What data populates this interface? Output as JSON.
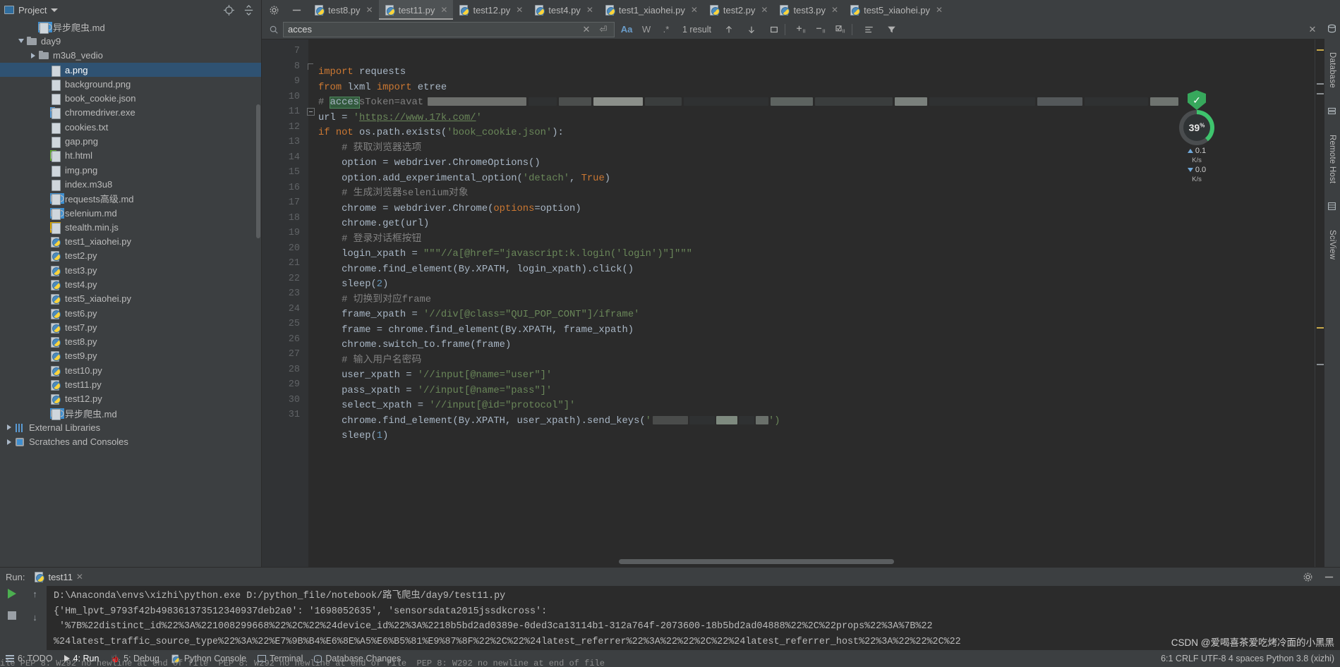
{
  "window": {
    "project_panel_title": "Project",
    "icons": {
      "locate": "crosshair-icon",
      "collapse": "collapse-all-icon",
      "settings": "gear-icon",
      "minimize": "minimize-icon",
      "project_view": "project-view-icon",
      "chevron": "chevron-down-icon"
    }
  },
  "sidebar": {
    "items": [
      {
        "label": "异步爬虫.md",
        "icon": "md-file-icon",
        "indent": 2,
        "kind": "md",
        "arrow": "none",
        "selected": false,
        "clipped": true
      },
      {
        "label": "day9",
        "icon": "folder-icon",
        "indent": 1,
        "kind": "folder",
        "arrow": "open",
        "selected": false
      },
      {
        "label": "m3u8_vedio",
        "icon": "folder-icon",
        "indent": 2,
        "kind": "folder",
        "arrow": "closed",
        "selected": false
      },
      {
        "label": "a.png",
        "icon": "png-file-icon",
        "indent": 3,
        "kind": "png",
        "arrow": "none",
        "selected": true
      },
      {
        "label": "background.png",
        "icon": "png-file-icon",
        "indent": 3,
        "kind": "png",
        "arrow": "none",
        "selected": false
      },
      {
        "label": "book_cookie.json",
        "icon": "json-file-icon",
        "indent": 3,
        "kind": "json",
        "arrow": "none",
        "selected": false
      },
      {
        "label": "chromedriver.exe",
        "icon": "exe-file-icon",
        "indent": 3,
        "kind": "exe",
        "arrow": "none",
        "selected": false
      },
      {
        "label": "cookies.txt",
        "icon": "txt-file-icon",
        "indent": 3,
        "kind": "txt",
        "arrow": "none",
        "selected": false
      },
      {
        "label": "gap.png",
        "icon": "png-file-icon",
        "indent": 3,
        "kind": "png",
        "arrow": "none",
        "selected": false
      },
      {
        "label": "ht.html",
        "icon": "html-file-icon",
        "indent": 3,
        "kind": "html",
        "arrow": "none",
        "selected": false
      },
      {
        "label": "img.png",
        "icon": "png-file-icon",
        "indent": 3,
        "kind": "png",
        "arrow": "none",
        "selected": false
      },
      {
        "label": "index.m3u8",
        "icon": "file-icon",
        "indent": 3,
        "kind": "doc",
        "arrow": "none",
        "selected": false
      },
      {
        "label": "requests高级.md",
        "icon": "md-file-icon",
        "indent": 3,
        "kind": "md",
        "arrow": "none",
        "selected": false
      },
      {
        "label": "selenium.md",
        "icon": "md-file-icon",
        "indent": 3,
        "kind": "md",
        "arrow": "none",
        "selected": false
      },
      {
        "label": "stealth.min.js",
        "icon": "js-file-icon",
        "indent": 3,
        "kind": "js",
        "arrow": "none",
        "selected": false
      },
      {
        "label": "test1_xiaohei.py",
        "icon": "python-file-icon",
        "indent": 3,
        "kind": "py",
        "arrow": "none",
        "selected": false
      },
      {
        "label": "test2.py",
        "icon": "python-file-icon",
        "indent": 3,
        "kind": "py",
        "arrow": "none",
        "selected": false
      },
      {
        "label": "test3.py",
        "icon": "python-file-icon",
        "indent": 3,
        "kind": "py",
        "arrow": "none",
        "selected": false
      },
      {
        "label": "test4.py",
        "icon": "python-file-icon",
        "indent": 3,
        "kind": "py",
        "arrow": "none",
        "selected": false
      },
      {
        "label": "test5_xiaohei.py",
        "icon": "python-file-icon",
        "indent": 3,
        "kind": "py",
        "arrow": "none",
        "selected": false
      },
      {
        "label": "test6.py",
        "icon": "python-file-icon",
        "indent": 3,
        "kind": "py",
        "arrow": "none",
        "selected": false
      },
      {
        "label": "test7.py",
        "icon": "python-file-icon",
        "indent": 3,
        "kind": "py",
        "arrow": "none",
        "selected": false
      },
      {
        "label": "test8.py",
        "icon": "python-file-icon",
        "indent": 3,
        "kind": "py",
        "arrow": "none",
        "selected": false
      },
      {
        "label": "test9.py",
        "icon": "python-file-icon",
        "indent": 3,
        "kind": "py",
        "arrow": "none",
        "selected": false
      },
      {
        "label": "test10.py",
        "icon": "python-file-icon",
        "indent": 3,
        "kind": "py",
        "arrow": "none",
        "selected": false
      },
      {
        "label": "test11.py",
        "icon": "python-file-icon",
        "indent": 3,
        "kind": "py",
        "arrow": "none",
        "selected": false
      },
      {
        "label": "test12.py",
        "icon": "python-file-icon",
        "indent": 3,
        "kind": "py",
        "arrow": "none",
        "selected": false
      },
      {
        "label": "异步爬虫.md",
        "icon": "md-file-icon",
        "indent": 3,
        "kind": "md",
        "arrow": "none",
        "selected": false
      },
      {
        "label": "External Libraries",
        "icon": "library-icon",
        "indent": 0,
        "kind": "lib",
        "arrow": "closed",
        "selected": false
      },
      {
        "label": "Scratches and Consoles",
        "icon": "scratches-icon",
        "indent": 0,
        "kind": "scratch",
        "arrow": "closed",
        "selected": false
      }
    ]
  },
  "tabs": [
    {
      "label": "test8.py",
      "active": false
    },
    {
      "label": "test11.py",
      "active": true
    },
    {
      "label": "test12.py",
      "active": false
    },
    {
      "label": "test4.py",
      "active": false
    },
    {
      "label": "test1_xiaohei.py",
      "active": false
    },
    {
      "label": "test2.py",
      "active": false
    },
    {
      "label": "test3.py",
      "active": false
    },
    {
      "label": "test5_xiaohei.py",
      "active": false
    }
  ],
  "find": {
    "query": "acces",
    "placeholder": "Search",
    "result_count": "1 result",
    "match_case_label": "Aa",
    "words_label": "W",
    "regex_label": ".*",
    "icons": {
      "search": "search-icon",
      "clear": "close-icon",
      "reset": "reset-icon",
      "prev": "arrow-up-icon",
      "next": "arrow-down-icon",
      "select_all": "select-all-icon",
      "add_line": "add-selection-icon",
      "remove_line": "remove-selection-icon",
      "check_lines": "check-selection-icon",
      "indent": "indent-icon",
      "filter": "filter-icon"
    }
  },
  "editor": {
    "first_line_number": 7,
    "lines": [
      {
        "n": 7,
        "fold": "none",
        "segments": [
          {
            "t": "import",
            "c": "kw"
          },
          {
            "t": " requests",
            "c": ""
          }
        ]
      },
      {
        "n": 8,
        "fold": "corner",
        "segments": [
          {
            "t": "from",
            "c": "kw"
          },
          {
            "t": " lxml ",
            "c": ""
          },
          {
            "t": "import",
            "c": "kw"
          },
          {
            "t": " etree",
            "c": ""
          }
        ]
      },
      {
        "n": 9,
        "fold": "none",
        "segments": [
          {
            "t": "# ",
            "c": "cmt"
          },
          {
            "t": "acces",
            "c": "hl"
          },
          {
            "t": "sToken=avat",
            "c": "cmt"
          }
        ],
        "redacted": true
      },
      {
        "n": 10,
        "fold": "none",
        "segments": [
          {
            "t": "url = ",
            "c": ""
          },
          {
            "t": "'",
            "c": "str"
          },
          {
            "t": "https://www.17k.com/",
            "c": "link"
          },
          {
            "t": "'",
            "c": "str"
          }
        ]
      },
      {
        "n": 11,
        "fold": "minus",
        "segments": [
          {
            "t": "if not",
            "c": "kw"
          },
          {
            "t": " os.path.exists(",
            "c": ""
          },
          {
            "t": "'book_cookie.json'",
            "c": "str"
          },
          {
            "t": "):",
            "c": ""
          }
        ]
      },
      {
        "n": 12,
        "fold": "none",
        "segments": [
          {
            "t": "    # 获取浏览器选项",
            "c": "cmt"
          }
        ]
      },
      {
        "n": 13,
        "fold": "none",
        "segments": [
          {
            "t": "    option = webdriver.ChromeOptions()",
            "c": ""
          }
        ]
      },
      {
        "n": 14,
        "fold": "none",
        "segments": [
          {
            "t": "    option.add_experimental_option(",
            "c": ""
          },
          {
            "t": "'detach'",
            "c": "str"
          },
          {
            "t": ", ",
            "c": ""
          },
          {
            "t": "True",
            "c": "kw"
          },
          {
            "t": ")",
            "c": ""
          }
        ]
      },
      {
        "n": 15,
        "fold": "none",
        "segments": [
          {
            "t": "    # 生成浏览器selenium对象",
            "c": "cmt"
          }
        ]
      },
      {
        "n": 16,
        "fold": "none",
        "segments": [
          {
            "t": "    chrome = webdriver.Chrome(",
            "c": ""
          },
          {
            "t": "options",
            "c": "param"
          },
          {
            "t": "=option)",
            "c": ""
          }
        ]
      },
      {
        "n": 17,
        "fold": "none",
        "segments": [
          {
            "t": "    chrome.get(url)",
            "c": ""
          }
        ]
      },
      {
        "n": 18,
        "fold": "none",
        "segments": [
          {
            "t": "    # 登录对话框按钮",
            "c": "cmt"
          }
        ]
      },
      {
        "n": 19,
        "fold": "none",
        "segments": [
          {
            "t": "    login_xpath = ",
            "c": ""
          },
          {
            "t": "\"\"\"//a[@href=\"javascript:k.login('login')\"]\"\"\"",
            "c": "str"
          }
        ]
      },
      {
        "n": 20,
        "fold": "none",
        "segments": [
          {
            "t": "    chrome.find_element(By.XPATH, login_xpath).click()",
            "c": ""
          }
        ]
      },
      {
        "n": 21,
        "fold": "none",
        "segments": [
          {
            "t": "    sleep(",
            "c": ""
          },
          {
            "t": "2",
            "c": "num"
          },
          {
            "t": ")",
            "c": ""
          }
        ]
      },
      {
        "n": 22,
        "fold": "none",
        "segments": [
          {
            "t": "    # 切换到对应frame",
            "c": "cmt"
          }
        ]
      },
      {
        "n": 23,
        "fold": "none",
        "segments": [
          {
            "t": "    frame_xpath = ",
            "c": ""
          },
          {
            "t": "'//div[@class=\"QUI_POP_CONT\"]/iframe'",
            "c": "str"
          }
        ]
      },
      {
        "n": 24,
        "fold": "none",
        "segments": [
          {
            "t": "    frame = chrome.find_element(By.XPATH, frame_xpath)",
            "c": ""
          }
        ]
      },
      {
        "n": 25,
        "fold": "none",
        "segments": [
          {
            "t": "    chrome.switch_to.frame(frame)",
            "c": ""
          }
        ]
      },
      {
        "n": 26,
        "fold": "none",
        "segments": [
          {
            "t": "    # 输入用户名密码",
            "c": "cmt"
          }
        ]
      },
      {
        "n": 27,
        "fold": "none",
        "segments": [
          {
            "t": "    user_xpath = ",
            "c": ""
          },
          {
            "t": "'//input[@name=\"user\"]'",
            "c": "str"
          }
        ]
      },
      {
        "n": 28,
        "fold": "none",
        "segments": [
          {
            "t": "    pass_xpath = ",
            "c": ""
          },
          {
            "t": "'//input[@name=\"pass\"]'",
            "c": "str"
          }
        ]
      },
      {
        "n": 29,
        "fold": "none",
        "segments": [
          {
            "t": "    select_xpath = ",
            "c": ""
          },
          {
            "t": "'//input[@id=\"protocol\"]'",
            "c": "str"
          }
        ]
      },
      {
        "n": 30,
        "fold": "none",
        "segments": [
          {
            "t": "    chrome.find_element(By.XPATH, user_xpath).send_keys(",
            "c": ""
          },
          {
            "t": "'",
            "c": "str"
          }
        ],
        "redacted2": true
      },
      {
        "n": 31,
        "fold": "none",
        "segments": [
          {
            "t": "    sleep(",
            "c": ""
          },
          {
            "t": "1",
            "c": "num"
          },
          {
            "t": ")",
            "c": ""
          }
        ]
      }
    ]
  },
  "network_widget": {
    "percent": "39",
    "percent_suffix": "%",
    "upload_value": "0.1",
    "upload_unit": "K/s",
    "download_value": "0.0",
    "download_unit": "K/s",
    "shield_icon": "shield-check-icon"
  },
  "right_strip": [
    {
      "label": "Database",
      "icon": "database-icon"
    },
    {
      "label": "Remote Host",
      "icon": "remote-host-icon"
    },
    {
      "label": "SciView",
      "icon": "sciview-icon"
    }
  ],
  "run_panel": {
    "label": "Run:",
    "tab_label": "test11",
    "icons": {
      "settings": "gear-icon",
      "minimize": "minimize-icon",
      "run": "run-icon",
      "stop": "stop-icon",
      "up": "arrow-up-icon",
      "down": "arrow-down-icon"
    },
    "console_lines": [
      "D:\\Anaconda\\envs\\xizhi\\python.exe D:/python_file/notebook/路飞爬虫/day9/test11.py",
      "{'Hm_lpvt_9793f42b498361373512340937deb2a0': '1698052635', 'sensorsdata2015jssdkcross':",
      " '%7B%22distinct_id%22%3A%221008299668%22%2C%22%24device_id%22%3A%2218b5bd2ad0389e-0ded3ca13114b1-312a764f-2073600-18b5bd2ad04888%22%2C%22props%22%3A%7B%22",
      "%24latest_traffic_source_type%22%3A%22%E7%9B%B4%E6%8E%A5%E6%B5%81%E9%87%8F%22%2C%22%24latest_referrer%22%3A%22%22%2C%22%24latest_referrer_host%22%3A%22%22%2C%22"
    ]
  },
  "status_bar": {
    "items": [
      {
        "label": "6: TODO",
        "icon": "todo-icon",
        "active": false
      },
      {
        "label": "4: Run",
        "icon": "run-icon",
        "active": true
      },
      {
        "label": "5: Debug",
        "icon": "debug-icon",
        "active": false
      },
      {
        "label": "Python Console",
        "icon": "python-console-icon",
        "active": false
      },
      {
        "label": "Terminal",
        "icon": "terminal-icon",
        "active": false
      },
      {
        "label": "Database Changes",
        "icon": "database-changes-icon",
        "active": false
      }
    ],
    "right_text": "6:1   CRLF  UTF-8   4 spaces  Python 3.8 (xizhi)",
    "bottom_message": "ile PEP 8: W292 no newline at end of file  PEP 8: W292 no newline at end of file  PEP 8: W292 no newline at end of file"
  },
  "watermark": "CSDN @爱喝喜茶爱吃烤冷面的小黑黑",
  "colors": {
    "accent_blue": "#2f5272",
    "editor_bg": "#2b2b2b",
    "panel_bg": "#3c3f41",
    "string_green": "#6a8759",
    "keyword_orange": "#cc7832",
    "number_blue": "#6897bb",
    "comment_gray": "#808080",
    "gauge_green": "#3ec46d"
  }
}
